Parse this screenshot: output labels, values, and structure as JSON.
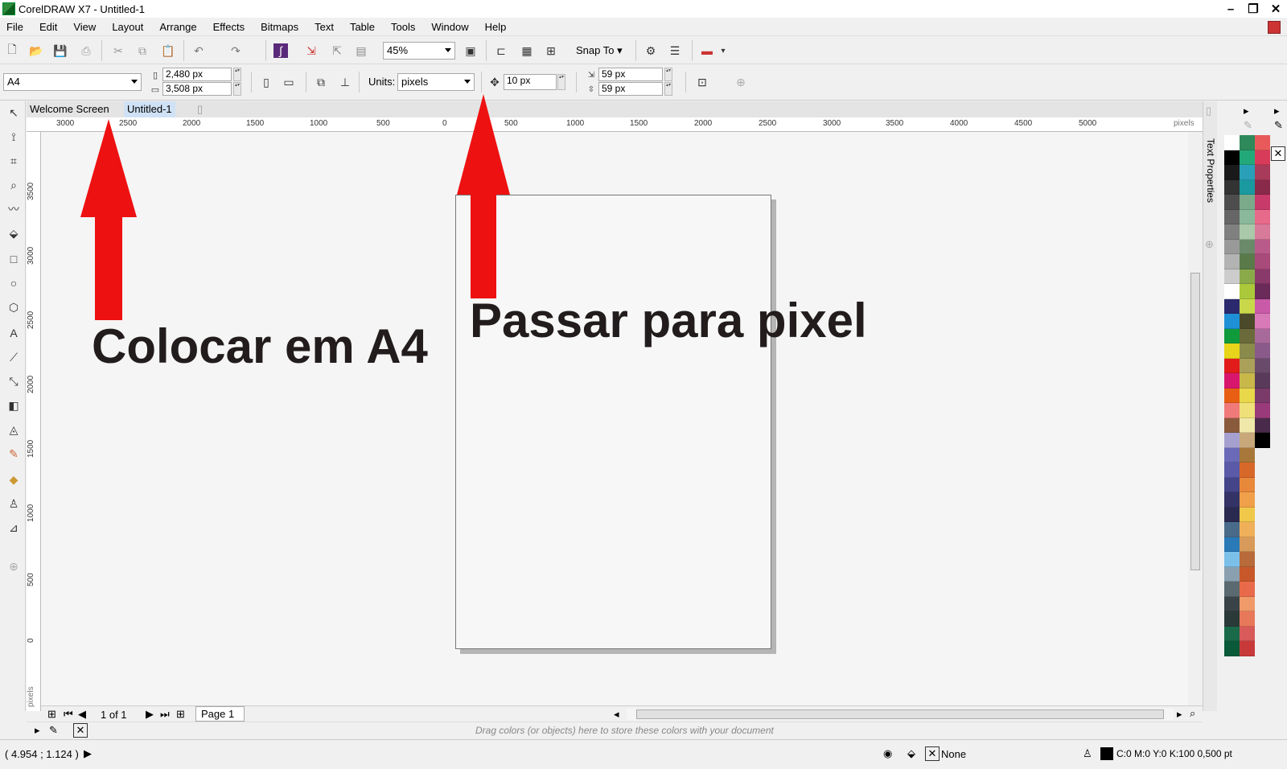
{
  "window": {
    "title": "CorelDRAW X7 - Untitled-1"
  },
  "menu": [
    "File",
    "Edit",
    "View",
    "Layout",
    "Arrange",
    "Effects",
    "Bitmaps",
    "Text",
    "Table",
    "Tools",
    "Window",
    "Help"
  ],
  "toolbar": {
    "zoom": "45%",
    "snap_to": "Snap To"
  },
  "property_bar": {
    "page_size": "A4",
    "width": "2,480 px",
    "height": "3,508 px",
    "units_label": "Units:",
    "units": "pixels",
    "nudge": "10 px",
    "dup_x": "59 px",
    "dup_y": "59 px"
  },
  "doc_tabs": [
    "Welcome Screen",
    "Untitled-1"
  ],
  "h_ruler": {
    "ticks": [
      "3000",
      "2500",
      "2000",
      "1500",
      "1000",
      "500",
      "0",
      "500",
      "1000",
      "1500",
      "2000",
      "2500",
      "3000",
      "3500",
      "4000",
      "4500",
      "5000"
    ],
    "unit": "pixels"
  },
  "v_ruler": {
    "ticks": [
      "3500",
      "3000",
      "2500",
      "2000",
      "1500",
      "1000",
      "500",
      "0"
    ],
    "unit": "pixels"
  },
  "annotations": {
    "left": "Colocar em A4",
    "right": "Passar para pixel",
    "arrow_color": "#ee1111"
  },
  "page_nav": {
    "counter": "1 of 1",
    "page_tab": "Page 1"
  },
  "color_docker": {
    "hint": "Drag colors (or objects) here to store these colors with your document"
  },
  "status": {
    "coords": "( 4.954 ; 1.124 )",
    "fill": "None",
    "outline": "C:0 M:0 Y:0 K:100  0,500 pt"
  },
  "docker": {
    "label": "Text Properties"
  },
  "palette": {
    "col1": [
      "#ffffff",
      "#000000",
      "#1a1a1a",
      "#333333",
      "#4d4d4d",
      "#666666",
      "#808080",
      "#999999",
      "#b3b3b3",
      "#cccccc",
      "#ffffff",
      "#2b2a6e",
      "#1e90d6",
      "#0f9a3c",
      "#e8d41a",
      "#e21b1b",
      "#d8166d",
      "#e85f14",
      "#f07a7a",
      "#8a5a3c",
      "#a6a0d0",
      "#6a6ab8",
      "#5a5aa8",
      "#444488",
      "#333366",
      "#2a2a50",
      "#4a6a8a",
      "#2a7ab8",
      "#7ac0e8",
      "#8aa0b0",
      "#5a6a70",
      "#3a4448",
      "#2a3a38",
      "#1a6a4a",
      "#0a5a3a"
    ],
    "col2": [
      "#2e8a5a",
      "#23a87a",
      "#2aa0b8",
      "#1a9aa0",
      "#7aaa8a",
      "#8ab89a",
      "#aac8aa",
      "#6a8a6a",
      "#5a7a4a",
      "#8aaa4a",
      "#aac83a",
      "#c8d84a",
      "#4a4a2a",
      "#6a6a3a",
      "#8a8a4a",
      "#aaa05a",
      "#c8b84a",
      "#e8d84a",
      "#f0e07a",
      "#f0e8aa",
      "#c8a87a",
      "#a8783a",
      "#d8682a",
      "#e8883a",
      "#f0a04a",
      "#f0c84a",
      "#f0b05a",
      "#d89a5a",
      "#b86a3a",
      "#c8582a",
      "#e86a4a",
      "#f09a6a",
      "#e8785a",
      "#d85a5a",
      "#c83a3a"
    ],
    "col3": [
      "#e85a5a",
      "#d83a5a",
      "#a83a5a",
      "#8a2a4a",
      "#c83a6a",
      "#e86a8a",
      "#d87a9a",
      "#b85a8a",
      "#a84a7a",
      "#8a3a6a",
      "#6a2a5a",
      "#c85aa8",
      "#d87ab8",
      "#a86a9a",
      "#8a5a8a",
      "#6a4a6a",
      "#5a3a5a",
      "#7a3a6a",
      "#9a3a7a",
      "#4a2a4a",
      "#000000"
    ]
  }
}
